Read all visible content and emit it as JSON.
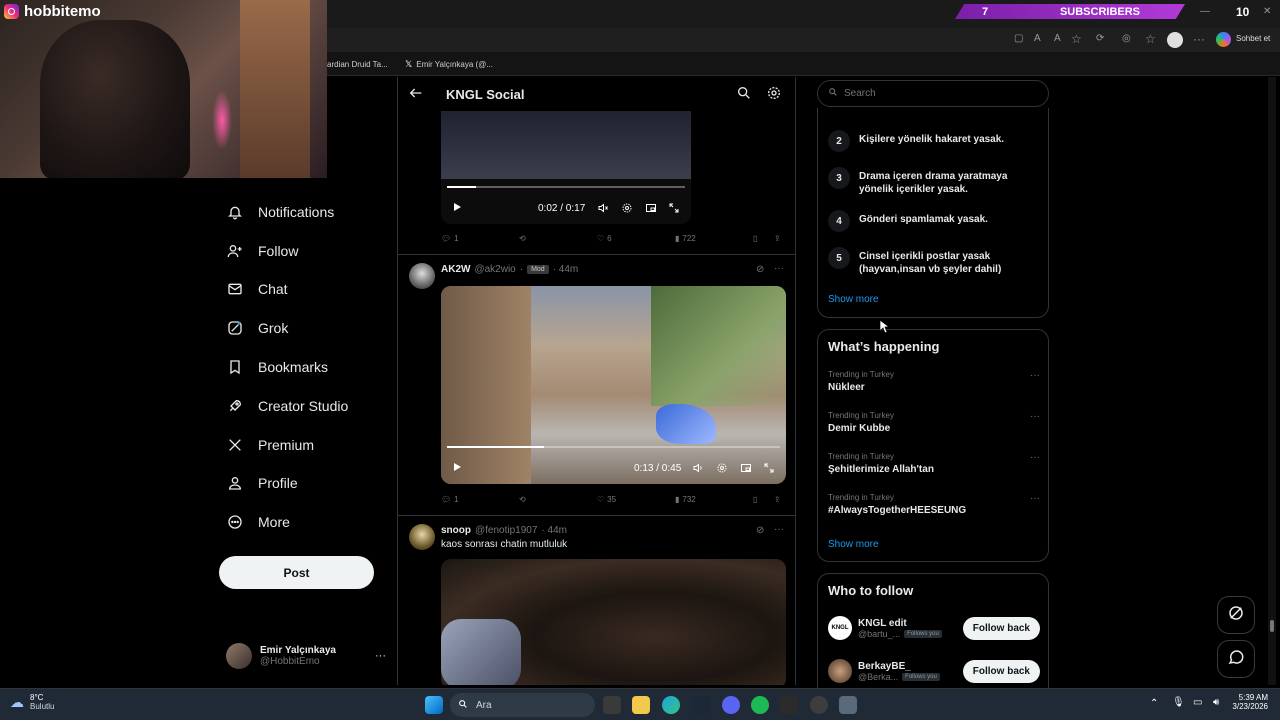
{
  "overlay": {
    "channel_name": "hobbitemo",
    "subscriber_count": "7",
    "subscriber_label": "SUBSCRIBERS",
    "corner_number": "10"
  },
  "browser": {
    "tabs": [
      {
        "label": "ardian Druid Ta..."
      },
      {
        "label": "Emir Yalçınkaya (@..."
      }
    ],
    "chat_button": "Sohbet et"
  },
  "nav": {
    "items": [
      {
        "label": "Notifications",
        "icon": "bell-icon"
      },
      {
        "label": "Follow",
        "icon": "person-plus-icon"
      },
      {
        "label": "Chat",
        "icon": "mail-icon"
      },
      {
        "label": "Grok",
        "icon": "grok-icon"
      },
      {
        "label": "Bookmarks",
        "icon": "bookmark-icon"
      },
      {
        "label": "Creator Studio",
        "icon": "rocket-icon"
      },
      {
        "label": "Premium",
        "icon": "x-logo-icon"
      },
      {
        "label": "Profile",
        "icon": "person-icon"
      },
      {
        "label": "More",
        "icon": "more-circle-icon"
      }
    ],
    "post_button": "Post",
    "profile": {
      "name": "Emir Yalçınkaya",
      "handle": "@HobbitEmo"
    }
  },
  "main": {
    "title": "KNGL Social",
    "posts": [
      {
        "video_time": "0:02 / 0:17",
        "video_progress": 0.12,
        "replies": "1",
        "likes": "6",
        "views": "722"
      },
      {
        "name": "AK2W",
        "handle": "@ak2wio",
        "badge": "Mod",
        "time": "· 44m",
        "video_time": "0:13 / 0:45",
        "video_progress": 0.29,
        "replies": "1",
        "likes": "35",
        "views": "732"
      },
      {
        "name": "snoop",
        "handle": "@fenotip1907",
        "time": "· 44m",
        "text": "kaos sonrası chatin mutluluk"
      }
    ]
  },
  "sidebar": {
    "search_placeholder": "Search",
    "rules": [
      {
        "num": "2",
        "text": "Kişilere yönelik hakaret yasak."
      },
      {
        "num": "3",
        "text": "Drama içeren drama yaratmaya yönelik içerikler yasak."
      },
      {
        "num": "4",
        "text": "Gönderi spamlamak yasak."
      },
      {
        "num": "5",
        "text": "Cinsel içerikli postlar yasak (hayvan,insan vb şeyler dahil)"
      }
    ],
    "rules_show_more": "Show more",
    "happening_title": "What’s happening",
    "trends": [
      {
        "context": "Trending in Turkey",
        "topic": "Nükleer"
      },
      {
        "context": "Trending in Turkey",
        "topic": "Demir Kubbe"
      },
      {
        "context": "Trending in Turkey",
        "topic": "Şehitlerimize Allah'tan"
      },
      {
        "context": "Trending in Turkey",
        "topic": "#AlwaysTogetherHEESEUNG"
      }
    ],
    "trends_show_more": "Show more",
    "who_to_follow_title": "Who to follow",
    "who_to_follow": [
      {
        "name": "KNGL edit",
        "handle": "@bartu_...",
        "badge": "Follows you",
        "button": "Follow back"
      },
      {
        "name": "BerkayBE_",
        "handle": "@Berka...",
        "badge": "Follows you",
        "button": "Follow back"
      }
    ]
  },
  "taskbar": {
    "weather_temp": "8°C",
    "weather_desc": "Bulutlu",
    "search_placeholder": "Ara",
    "time": "5:39 AM",
    "date": "3/23/2026"
  }
}
